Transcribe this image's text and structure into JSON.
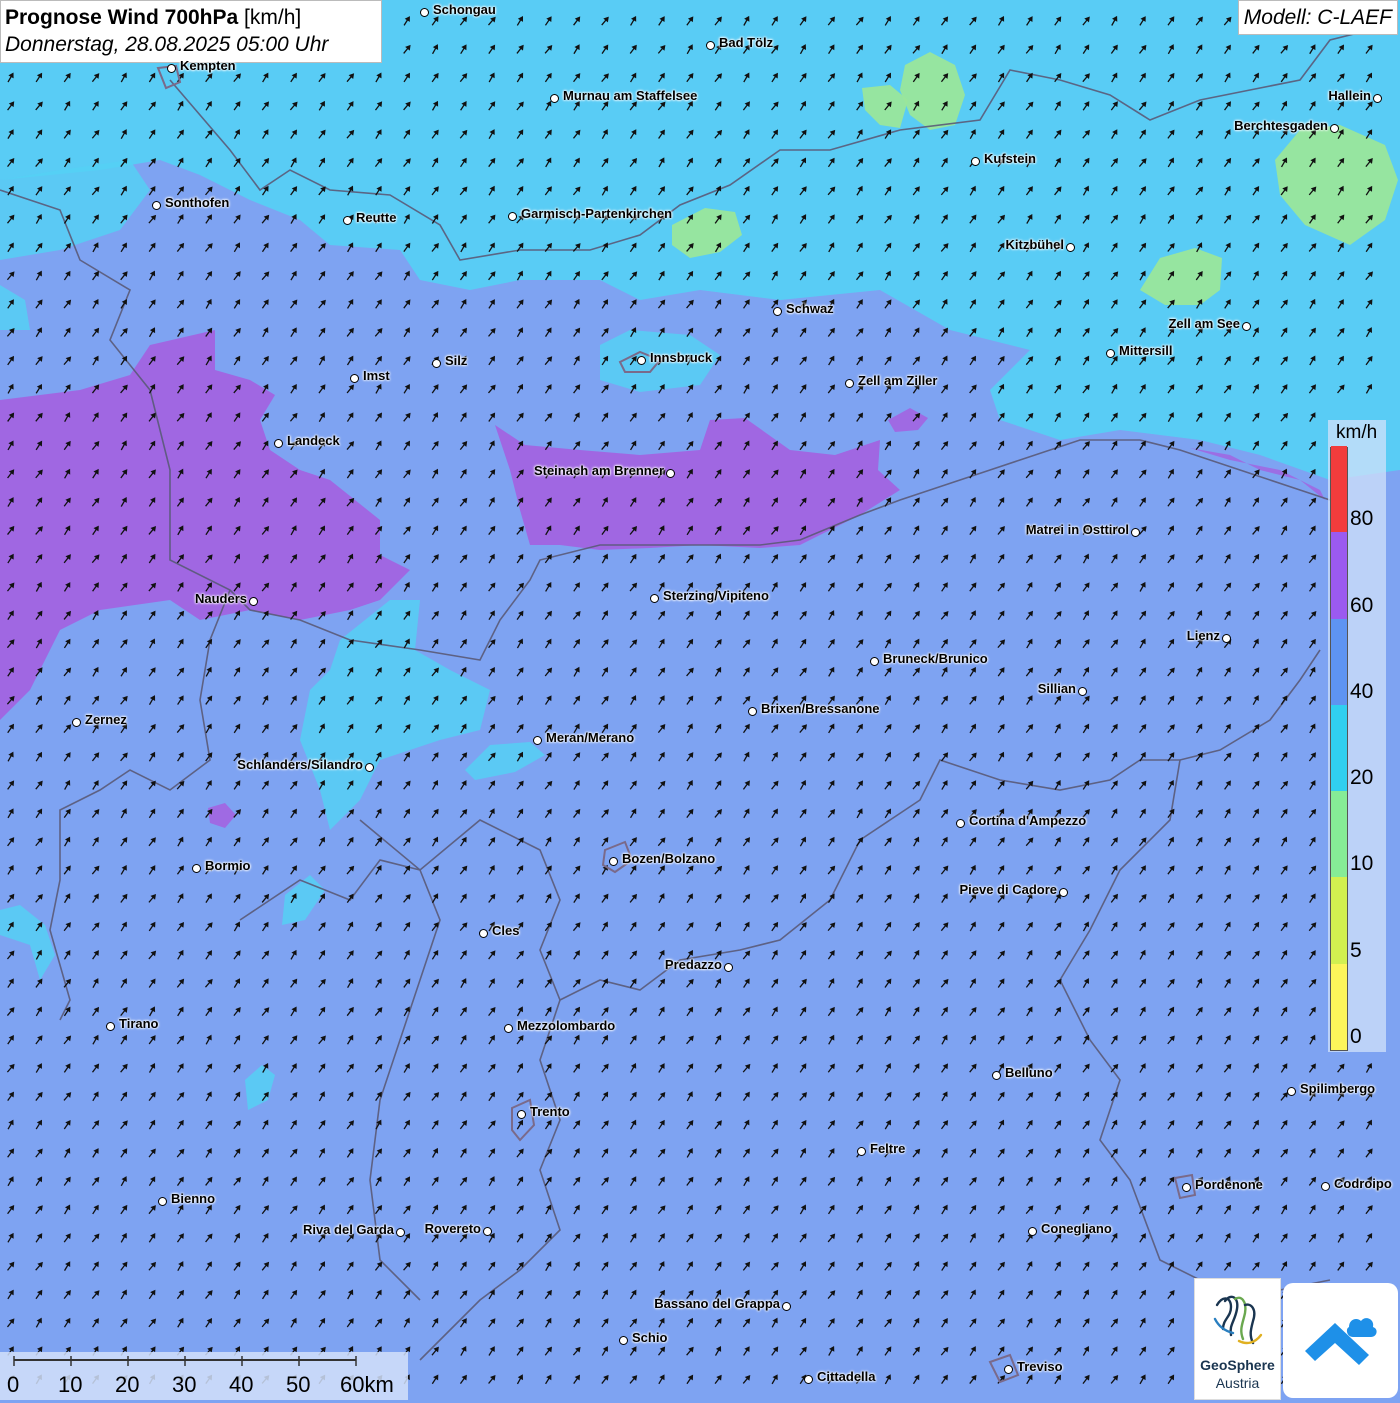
{
  "header": {
    "title_bold": "Prognose Wind 700hPa",
    "title_unit": "[km/h]",
    "subtitle": "Donnerstag, 28.08.2025 05:00 Uhr"
  },
  "model": "Modell: C-LAEF",
  "legend": {
    "title": "km/h",
    "classes": [
      {
        "label": "0",
        "color": "#fdf55a"
      },
      {
        "label": "5",
        "color": "#d2f050"
      },
      {
        "label": "10",
        "color": "#86ec96"
      },
      {
        "label": "20",
        "color": "#30cff0"
      },
      {
        "label": "40",
        "color": "#5e94f2"
      },
      {
        "label": "60",
        "color": "#9b5af0"
      },
      {
        "label": "80",
        "color": "#f23c3c"
      }
    ]
  },
  "scalebar": {
    "ticks": [
      "0",
      "10",
      "20",
      "30",
      "40",
      "50"
    ],
    "end_label": "60km"
  },
  "colors": {
    "base_field": "#7ea3f2",
    "cyan_zone": "#55d0f5",
    "green_zone": "#9ae69b",
    "purple_zone": "#a460e0",
    "arrow": "#111111"
  },
  "wind_direction": "southwest-to-northeast",
  "logos": {
    "geosphere_line1": "GeoSphere",
    "geosphere_line2": "Austria"
  },
  "cities": [
    {
      "name": "Schongau"
    },
    {
      "name": "Bad Tölz"
    },
    {
      "name": "Kempten"
    },
    {
      "name": "Murnau am Staffelsee"
    },
    {
      "name": "Hallein"
    },
    {
      "name": "Berchtesgaden"
    },
    {
      "name": "Kufstein"
    },
    {
      "name": "Sonthofen"
    },
    {
      "name": "Reutte"
    },
    {
      "name": "Garmisch-Partenkirchen"
    },
    {
      "name": "Kitzbühel"
    },
    {
      "name": "Schwaz"
    },
    {
      "name": "Zell am See"
    },
    {
      "name": "Mittersill"
    },
    {
      "name": "Innsbruck"
    },
    {
      "name": "Silz"
    },
    {
      "name": "Imst"
    },
    {
      "name": "Zell am Ziller"
    },
    {
      "name": "Landeck"
    },
    {
      "name": "Steinach am Brenner"
    },
    {
      "name": "Matrei in Osttirol"
    },
    {
      "name": "Nauders"
    },
    {
      "name": "Sterzing/Vipiteno"
    },
    {
      "name": "Lienz"
    },
    {
      "name": "Bruneck/Brunico"
    },
    {
      "name": "Sillian"
    },
    {
      "name": "Brixen/Bressanone"
    },
    {
      "name": "Zernez"
    },
    {
      "name": "Meran/Merano"
    },
    {
      "name": "Schlanders/Silandro"
    },
    {
      "name": "Cortina d'Ampezzo"
    },
    {
      "name": "Bormio"
    },
    {
      "name": "Bozen/Bolzano"
    },
    {
      "name": "Pieve di Cadore"
    },
    {
      "name": "Cles"
    },
    {
      "name": "Predazzo"
    },
    {
      "name": "Tirano"
    },
    {
      "name": "Mezzolombardo"
    },
    {
      "name": "Belluno"
    },
    {
      "name": "Spilimbergo"
    },
    {
      "name": "Trento"
    },
    {
      "name": "Feltre"
    },
    {
      "name": "Pordenone"
    },
    {
      "name": "Codroipo"
    },
    {
      "name": "Bienno"
    },
    {
      "name": "Riva del Garda"
    },
    {
      "name": "Rovereto"
    },
    {
      "name": "Conegliano"
    },
    {
      "name": "Bassano del Grappa"
    },
    {
      "name": "Schio"
    },
    {
      "name": "Treviso"
    },
    {
      "name": "Cittadella"
    }
  ]
}
